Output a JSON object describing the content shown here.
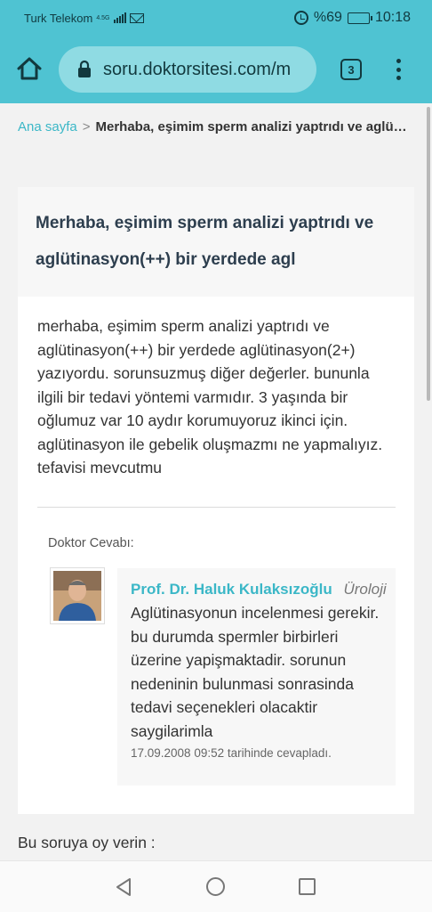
{
  "status_bar": {
    "carrier": "Turk Telekom",
    "network": "4.5G",
    "battery": "%69",
    "battery_level": 0.69,
    "time": "10:18"
  },
  "browser": {
    "url": "soru.doktorsitesi.com/m",
    "tab_count": "3"
  },
  "breadcrumb": {
    "home": "Ana sayfa",
    "separator": ">",
    "current": "Merhaba, eşimim sperm analizi yaptrıdı ve aglütinasyon(++) bir yerdede agl"
  },
  "question": {
    "title": "Merhaba, eşimim sperm analizi yaptrıdı ve aglütinasyon(++) bir yerdede agl",
    "body": "merhaba, eşimim sperm analizi yaptrıdı ve aglütinasyon(++) bir yerdede aglütinasyon(2+) yazıyordu. sorunsuzmuş diğer değerler. bununla ilgili bir tedavi yöntemi varmıdır. 3 yaşında bir oğlumuz var 10 aydır korumuyoruz ikinci için. aglütinasyon ile gebelik oluşmazmı ne yapmalıyız. tefavisi mevcutmu"
  },
  "answer": {
    "label": "Doktor Cevabı:",
    "doctor_name": "Prof. Dr. Haluk Kulaksızoğlu",
    "specialty": "Üroloji",
    "text": "Aglütinasyonun incelenmesi gerekir. bu durumda spermler birbirleri üzerine yapişmaktadir. sorunun nedeninin bulunmasi sonrasinda tedavi seçenekleri olacaktir saygilarimla",
    "date": "17.09.2008 09:52 tarihinde cevapladı."
  },
  "vote": {
    "label": "Bu soruya oy verin :"
  },
  "colors": {
    "accent": "#4fc3d2",
    "link": "#3bb7c7",
    "url_bar": "#8fdbe3"
  }
}
